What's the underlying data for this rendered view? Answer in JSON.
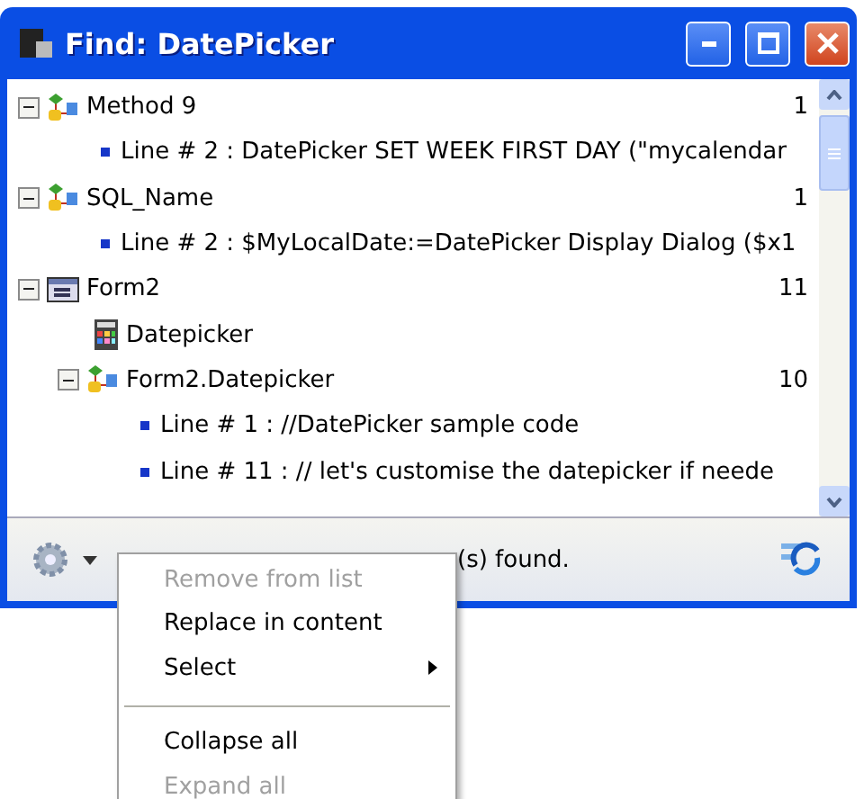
{
  "window": {
    "title": "Find: DatePicker"
  },
  "results": [
    {
      "kind": "method",
      "label": "Method 9",
      "count": "1",
      "expanded": true,
      "children": [
        {
          "kind": "line",
          "label": "Line # 2 : DatePicker SET WEEK FIRST DAY (\"mycalendar"
        }
      ]
    },
    {
      "kind": "method",
      "label": "SQL_Name",
      "count": "1",
      "expanded": true,
      "children": [
        {
          "kind": "line",
          "label": "Line # 2 : $MyLocalDate:=DatePicker Display Dialog ($x1"
        }
      ]
    },
    {
      "kind": "form",
      "label": "Form2",
      "count": "11",
      "expanded": true,
      "children": [
        {
          "kind": "object",
          "label": "Datepicker"
        },
        {
          "kind": "method",
          "label": "Form2.Datepicker",
          "count": "10",
          "expanded": true,
          "children": [
            {
              "kind": "line",
              "label": "Line # 1 :   //DatePicker sample code"
            },
            {
              "kind": "line",
              "label": "Line # 11 :   // let's customise the datepicker if neede"
            }
          ]
        }
      ]
    }
  ],
  "status": "(s) found.",
  "menu": [
    {
      "kind": "item",
      "label": "Remove from list",
      "disabled": true
    },
    {
      "kind": "item",
      "label": "Replace in content",
      "disabled": false
    },
    {
      "kind": "submenu",
      "label": "Select",
      "disabled": false
    },
    {
      "kind": "separator"
    },
    {
      "kind": "item",
      "label": "Collapse all",
      "disabled": false
    },
    {
      "kind": "item",
      "label": "Expand all",
      "disabled": true
    }
  ]
}
